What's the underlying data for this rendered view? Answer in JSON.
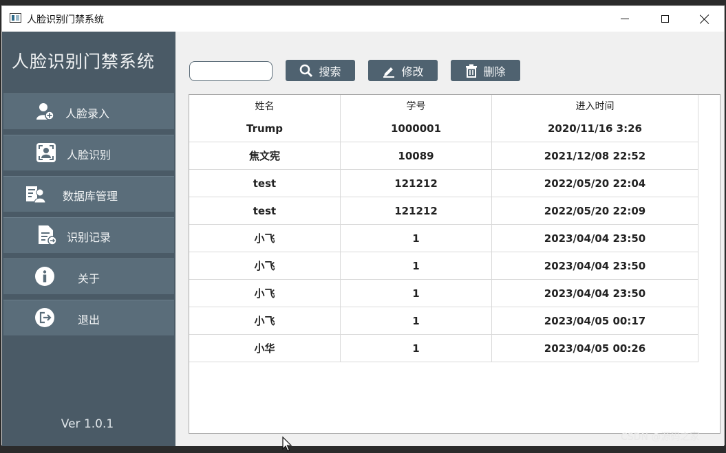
{
  "window": {
    "title": "人脸识别门禁系统"
  },
  "sidebar": {
    "brand": "人脸识别门禁系统",
    "items": [
      {
        "label": "人脸录入",
        "icon": "user-add-icon"
      },
      {
        "label": "人脸识别",
        "icon": "face-scan-icon"
      },
      {
        "label": "数据库管理",
        "icon": "database-user-icon"
      },
      {
        "label": "识别记录",
        "icon": "record-document-icon"
      },
      {
        "label": "关于",
        "icon": "info-icon"
      },
      {
        "label": "退出",
        "icon": "logout-icon"
      }
    ],
    "version": "Ver 1.0.1"
  },
  "toolbar": {
    "search_value": "",
    "search_label": "搜索",
    "edit_label": "修改",
    "delete_label": "删除"
  },
  "table": {
    "columns": [
      "姓名",
      "学号",
      "进入时间"
    ],
    "rows": [
      [
        "Trump",
        "1000001",
        "2020/11/16 3:26"
      ],
      [
        "焦文宪",
        "10089",
        "2021/12/08 22:52"
      ],
      [
        "test",
        "121212",
        "2022/05/20 22:04"
      ],
      [
        "test",
        "121212",
        "2022/05/20 22:09"
      ],
      [
        "小飞",
        "1",
        "2023/04/04 23:50"
      ],
      [
        "小飞",
        "1",
        "2023/04/04 23:50"
      ],
      [
        "小飞",
        "1",
        "2023/04/04 23:50"
      ],
      [
        "小飞",
        "1",
        "2023/04/05 00:17"
      ],
      [
        "小华",
        "1",
        "2023/04/05 00:26"
      ]
    ]
  },
  "watermark": "CSDN @源码之家",
  "colors": {
    "sidebar_bg": "#4a5a66",
    "nav_item_bg": "#5a6d7a",
    "button_bg": "#4f6270"
  }
}
